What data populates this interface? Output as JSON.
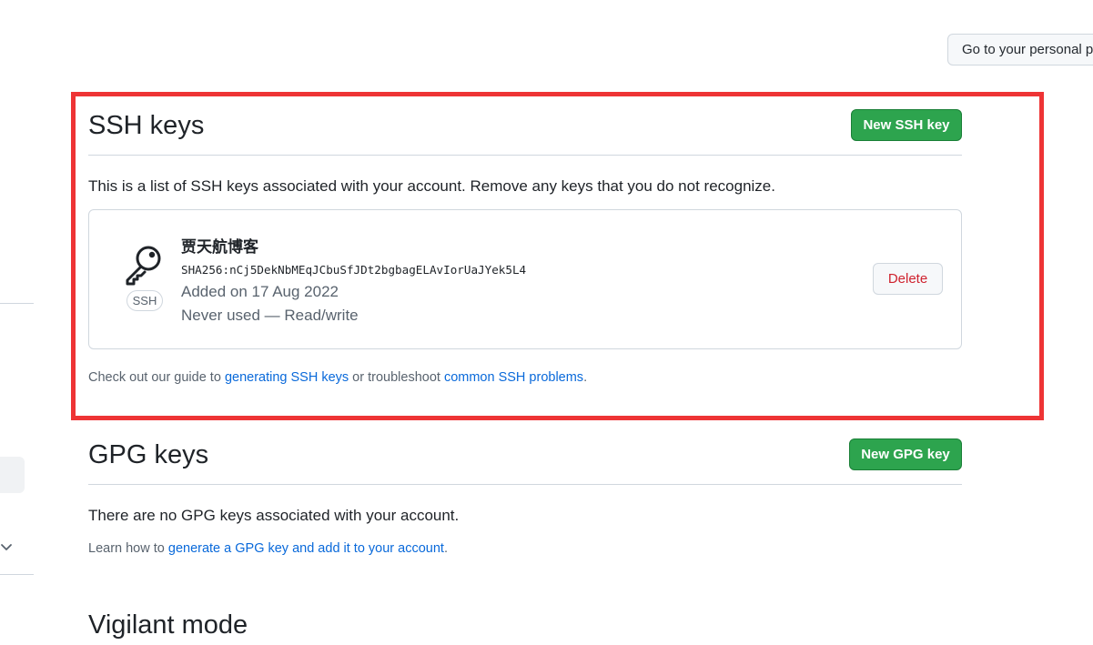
{
  "header": {
    "profile_button_label": "Go to your personal p"
  },
  "ssh_section": {
    "title": "SSH keys",
    "new_button_label": "New SSH key",
    "description": "This is a list of SSH keys associated with your account. Remove any keys that you do not recognize.",
    "keys": [
      {
        "title": "贾天航博客",
        "fingerprint": "SHA256:nCj5DekNbMEqJCbuSfJDt2bgbagELAvIorUaJYek5L4",
        "added": "Added on 17 Aug 2022",
        "usage": "Never used — Read/write",
        "badge": "SSH",
        "delete_label": "Delete",
        "icon": "key-icon"
      }
    ],
    "guide": {
      "prefix": "Check out our guide to ",
      "link1": "generating SSH keys",
      "middle": " or troubleshoot ",
      "link2": "common SSH problems",
      "suffix": "."
    }
  },
  "gpg_section": {
    "title": "GPG keys",
    "new_button_label": "New GPG key",
    "empty_message": "There are no GPG keys associated with your account.",
    "learn": {
      "prefix": "Learn how to ",
      "link": "generate a GPG key and add it to your account",
      "suffix": "."
    }
  },
  "vigilant_section": {
    "title": "Vigilant mode"
  },
  "colors": {
    "highlight_border": "#ee3435",
    "primary_button": "#2da44e",
    "link": "#0969da",
    "danger": "#cf222e"
  }
}
